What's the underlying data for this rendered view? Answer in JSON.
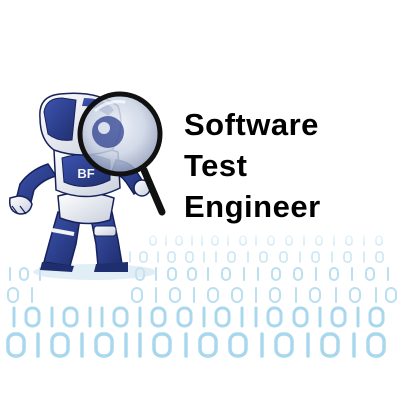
{
  "heading": {
    "line1": "Software",
    "line2": "Test",
    "line3": "Engineer"
  },
  "illustration": {
    "subject": "robot-with-magnifying-glass-icon",
    "chest_mark": "BF",
    "background": "binary-digits-floor"
  },
  "colors": {
    "robot_blue": "#2c3f8f",
    "robot_white": "#f2f4f8",
    "floor_digits": "#a9d8ee",
    "lens": "#c9d2e3",
    "text": "#000000"
  }
}
